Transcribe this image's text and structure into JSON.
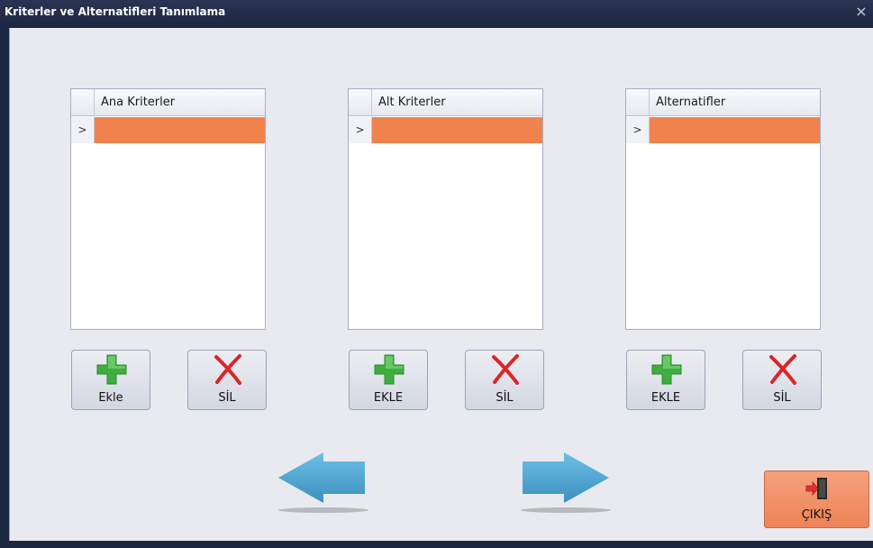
{
  "window": {
    "title": "Kriterler ve Alternatifleri Tanımlama",
    "close_glyph": "×"
  },
  "grids": [
    {
      "header": "Ana Kriterler",
      "row_indicator": ">"
    },
    {
      "header": "Alt Kriterler",
      "row_indicator": ">"
    },
    {
      "header": "Alternatifler",
      "row_indicator": ">"
    }
  ],
  "buttons": {
    "ana_add": "Ekle",
    "ana_delete": "SİL",
    "alt_add": "EKLE",
    "alt_delete": "SİL",
    "alternatif_add": "EKLE",
    "alternatif_delete": "SİL",
    "exit": "ÇIKIŞ"
  },
  "icons": {
    "add": "plus-icon",
    "delete": "x-icon",
    "exit": "exit-door-icon",
    "back": "arrow-left-icon",
    "forward": "arrow-right-icon"
  },
  "colors": {
    "selected_row": "#f0824d",
    "exit_button": "#f39067",
    "arrow": "#4aa3cf",
    "add_icon": "#3fae3f",
    "delete_icon": "#d9262a"
  }
}
